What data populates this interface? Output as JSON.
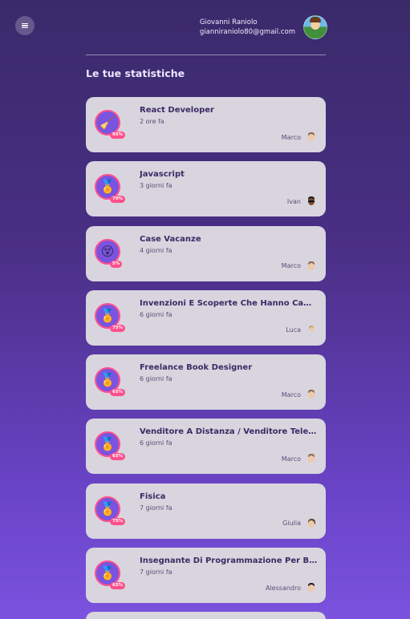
{
  "header": {
    "user_name": "Giovanni Raniolo",
    "user_email": "gianniraniolo80@gmail.com"
  },
  "section_title": "Le tue statistiche",
  "colors": {
    "accent": "#ff4f8b",
    "card_bg": "#d8d5df",
    "badge_bg": "#7a54e0"
  },
  "cards": [
    {
      "title": "React Developer",
      "time": "2 ore fa",
      "percent": "95%",
      "user": "Marco",
      "icon": "broom-icon"
    },
    {
      "title": "Javascript",
      "time": "3 giorni fa",
      "percent": "70%",
      "user": "Ivan",
      "icon": "medal-icon"
    },
    {
      "title": "Case Vacanze",
      "time": "4 giorni fa",
      "percent": "5%",
      "user": "Marco",
      "icon": "dizzy-face-icon"
    },
    {
      "title": "Invenzioni E Scoperte Che Hanno Cambia...",
      "time": "6 giorni fa",
      "percent": "75%",
      "user": "Luca",
      "icon": "medal-icon"
    },
    {
      "title": "Freelance Book Designer",
      "time": "6 giorni fa",
      "percent": "65%",
      "user": "Marco",
      "icon": "medal-icon"
    },
    {
      "title": "Venditore A Distanza / Venditore Telefoni...",
      "time": "6 giorni fa",
      "percent": "65%",
      "user": "Marco",
      "icon": "medal-icon"
    },
    {
      "title": "Fisica",
      "time": "7 giorni fa",
      "percent": "75%",
      "user": "Giulia",
      "icon": "medal-icon"
    },
    {
      "title": "Insegnante Di Programmazione Per Bambi...",
      "time": "7 giorni fa",
      "percent": "65%",
      "user": "Alessandro",
      "icon": "medal-icon"
    }
  ]
}
